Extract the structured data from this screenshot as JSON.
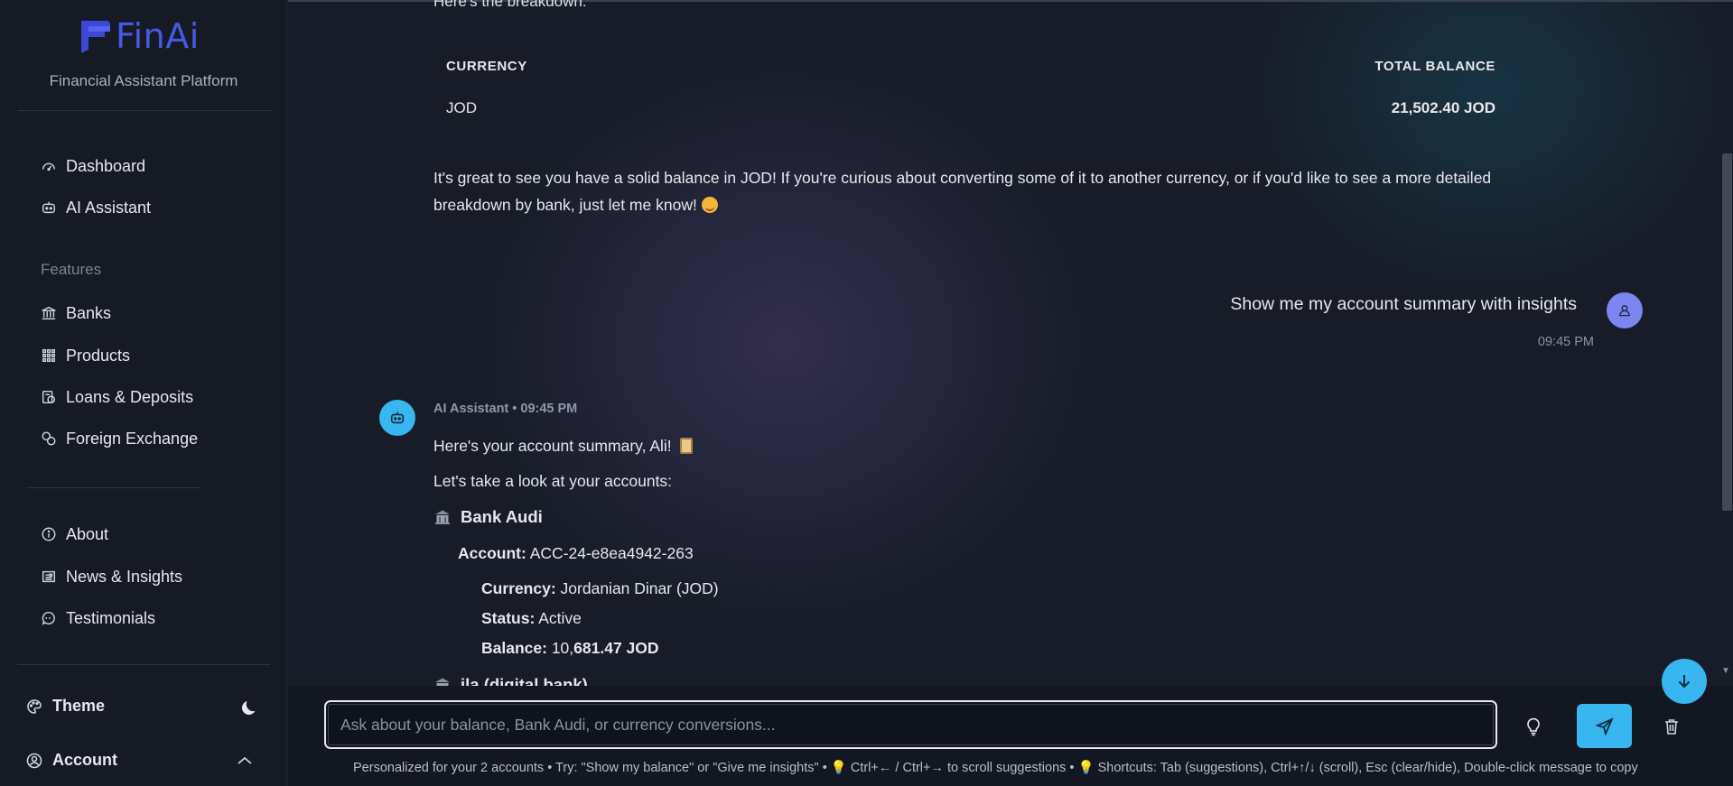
{
  "brand": {
    "name": "FinAi",
    "subtitle": "Financial Assistant Platform",
    "accent": "#4a58e8"
  },
  "sidebar": {
    "primary": [
      {
        "label": "Dashboard",
        "icon": "gauge-icon"
      },
      {
        "label": "AI Assistant",
        "icon": "robot-icon"
      }
    ],
    "features_label": "Features",
    "features": [
      {
        "label": "Banks",
        "icon": "bank-icon"
      },
      {
        "label": "Products",
        "icon": "grid-icon"
      },
      {
        "label": "Loans & Deposits",
        "icon": "loan-icon"
      },
      {
        "label": "Foreign Exchange",
        "icon": "coins-icon"
      }
    ],
    "info": [
      {
        "label": "About",
        "icon": "info-icon"
      },
      {
        "label": "News & Insights",
        "icon": "newspaper-icon"
      },
      {
        "label": "Testimonials",
        "icon": "chat-bubble-icon"
      }
    ],
    "theme_label": "Theme",
    "account_label": "Account"
  },
  "chat": {
    "clipped_top": "Here's the breakdown:",
    "balance_table": {
      "headers": [
        "CURRENCY",
        "TOTAL BALANCE"
      ],
      "rows": [
        [
          "JOD",
          "21,502.40 JOD"
        ]
      ]
    },
    "followup_1": "It's great to see you have a solid balance in JOD! If you're curious about converting some of it to another currency, or if you'd like to see a more detailed",
    "followup_2": "breakdown by bank, just let me know!",
    "user_message": "Show me my account summary with insights",
    "user_time": "09:45 PM",
    "bot_meta": "AI Assistant • 09:45 PM",
    "bot_greeting": "Here's your account summary, Ali!",
    "bot_intro": "Let's take a look at your accounts:",
    "bank_name": "Bank Audi",
    "account_label": "Account:",
    "account_value": "ACC-24-e8ea4942-263",
    "currency_label": "Currency:",
    "currency_value": "Jordanian Dinar (JOD)",
    "status_label": "Status:",
    "status_value": "Active",
    "balance_label": "Balance:",
    "balance_value_plain": "10,",
    "balance_value_bold": "681.47 JOD",
    "next_bank_clipped": "ila (digital bank)"
  },
  "input": {
    "placeholder": "Ask about your balance, Bank Audi, or currency conversions...",
    "value": "",
    "hint": "Personalized for your 2 accounts • Try: \"Show my balance\" or \"Give me insights\" • 💡 Ctrl+← / Ctrl+→ to scroll suggestions • 💡 Shortcuts: Tab (suggestions), Ctrl+↑/↓ (scroll), Esc (clear/hide), Double-click message to copy"
  },
  "colors": {
    "assistant_accent": "#38b6f0",
    "user_avatar": "#7c85f0"
  }
}
